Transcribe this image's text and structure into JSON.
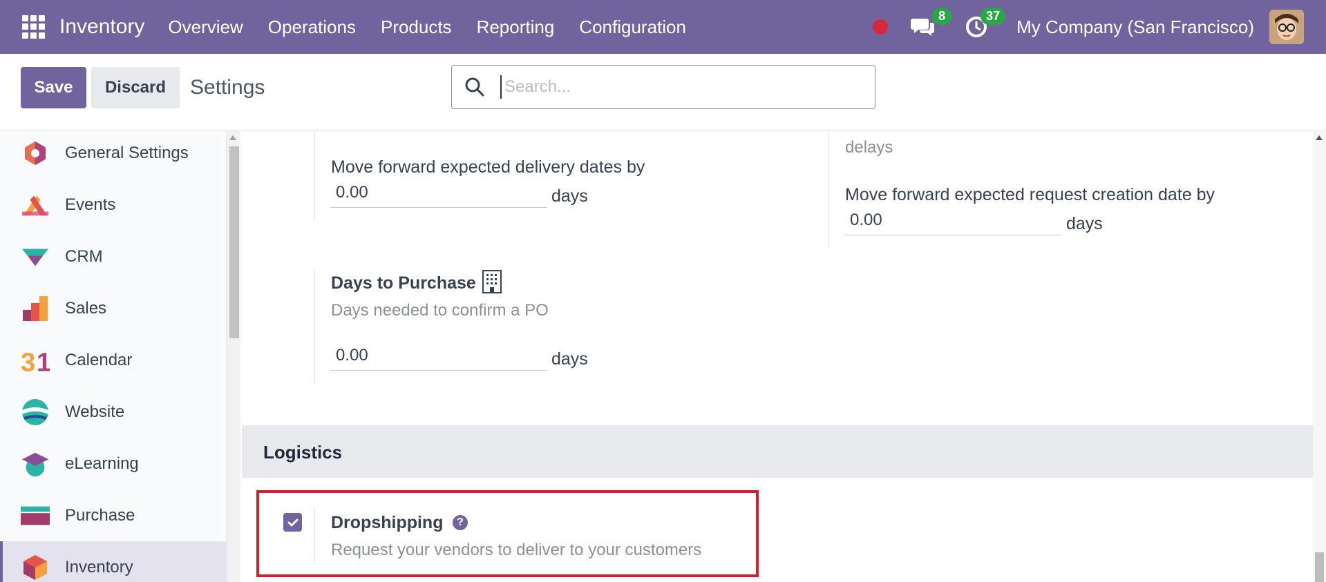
{
  "topbar": {
    "brand": "Inventory",
    "menu": [
      "Overview",
      "Operations",
      "Products",
      "Reporting",
      "Configuration"
    ],
    "chat_badge": "8",
    "activity_badge": "37",
    "company": "My Company (San Francisco)"
  },
  "control_panel": {
    "save_label": "Save",
    "discard_label": "Discard",
    "title": "Settings",
    "search_placeholder": "Search...",
    "search_value": ""
  },
  "sidebar": {
    "items": [
      {
        "label": "General Settings",
        "icon": "general-settings-icon"
      },
      {
        "label": "Events",
        "icon": "events-icon"
      },
      {
        "label": "CRM",
        "icon": "crm-icon"
      },
      {
        "label": "Sales",
        "icon": "sales-icon"
      },
      {
        "label": "Calendar",
        "icon": "calendar-icon"
      },
      {
        "label": "Website",
        "icon": "website-icon"
      },
      {
        "label": "eLearning",
        "icon": "elearning-icon"
      },
      {
        "label": "Purchase",
        "icon": "purchase-icon"
      },
      {
        "label": "Inventory",
        "icon": "inventory-icon"
      }
    ],
    "active": "Inventory"
  },
  "content": {
    "left_col": {
      "move_forward_label": "Move forward expected delivery dates by",
      "move_forward_value": "0.00",
      "days_unit": "days",
      "days_to_purchase_title": "Days to Purchase",
      "days_to_purchase_desc": "Days needed to confirm a PO",
      "days_to_purchase_value": "0.00"
    },
    "right_col": {
      "delays_text": "delays",
      "move_forward_request_label": "Move forward expected request creation date by",
      "move_forward_request_value": "0.00",
      "days_unit": "days"
    },
    "logistics": {
      "section_title": "Logistics",
      "dropshipping_title": "Dropshipping",
      "dropshipping_desc": "Request your vendors to deliver to your customers",
      "dropshipping_checked": true
    }
  },
  "colors": {
    "brand": "#71639e",
    "highlight": "#d0202a",
    "badge": "#28a745"
  }
}
